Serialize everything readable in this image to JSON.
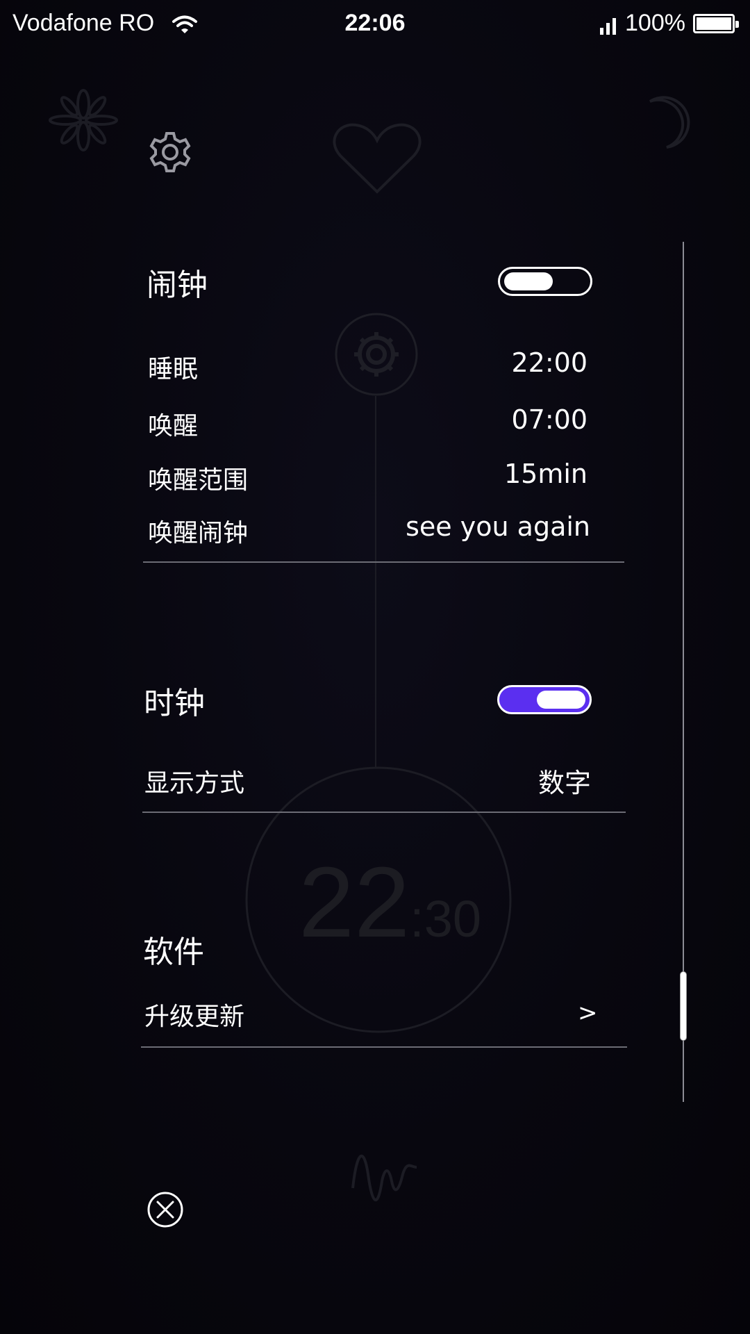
{
  "status_bar": {
    "carrier": "Vodafone RO",
    "time": "22:06",
    "battery_percent": "100%",
    "battery_level": 1.0
  },
  "background": {
    "clock_hour": "22",
    "clock_minute": ":30"
  },
  "alarm_section": {
    "title": "闹钟",
    "toggle_on": false,
    "rows": [
      {
        "label": "睡眠",
        "value": "22:00"
      },
      {
        "label": "唤醒",
        "value": "07:00"
      },
      {
        "label": "唤醒范围",
        "value": "15min"
      },
      {
        "label": "唤醒闹钟",
        "value": "see you again"
      }
    ]
  },
  "clock_section": {
    "title": "时钟",
    "toggle_on": true,
    "rows": [
      {
        "label": "显示方式",
        "value": "数字"
      }
    ]
  },
  "software_section": {
    "title": "软件",
    "rows": [
      {
        "label": "升级更新",
        "value": ">"
      }
    ]
  },
  "colors": {
    "accent": "#5b2ff0",
    "background": "#08070f",
    "divider": "#6c6c75"
  },
  "icons": [
    "wifi-icon",
    "signal-icon",
    "battery-icon",
    "gear-icon",
    "heart-icon",
    "moon-icon",
    "flower-icon",
    "close-icon",
    "chevron-right-icon",
    "wave-icon"
  ]
}
